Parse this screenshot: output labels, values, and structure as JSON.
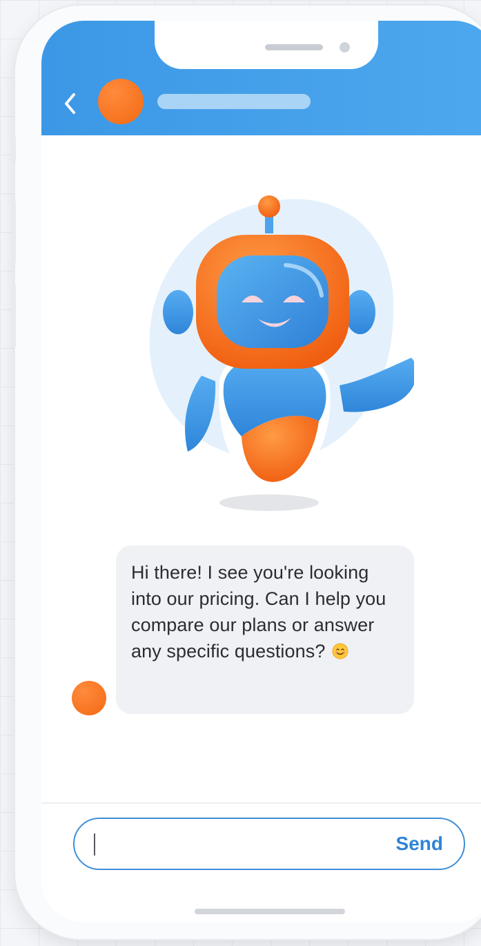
{
  "header": {
    "back_icon": "chevron-left-icon",
    "avatar_color": "#f2701a",
    "bar_color": "#3c98e6"
  },
  "chat": {
    "messages": [
      {
        "sender": "bot",
        "text": "Hi there! I see you're looking into our pricing. Can I help you compare our plans or answer any specific questions?",
        "emoji_icon": "smiling-face-icon"
      }
    ]
  },
  "composer": {
    "input_value": "",
    "input_placeholder": "",
    "send_label": "Send"
  },
  "colors": {
    "accent_blue": "#3e8fd8",
    "accent_orange": "#f2701a",
    "bubble": "#eff1f4"
  }
}
